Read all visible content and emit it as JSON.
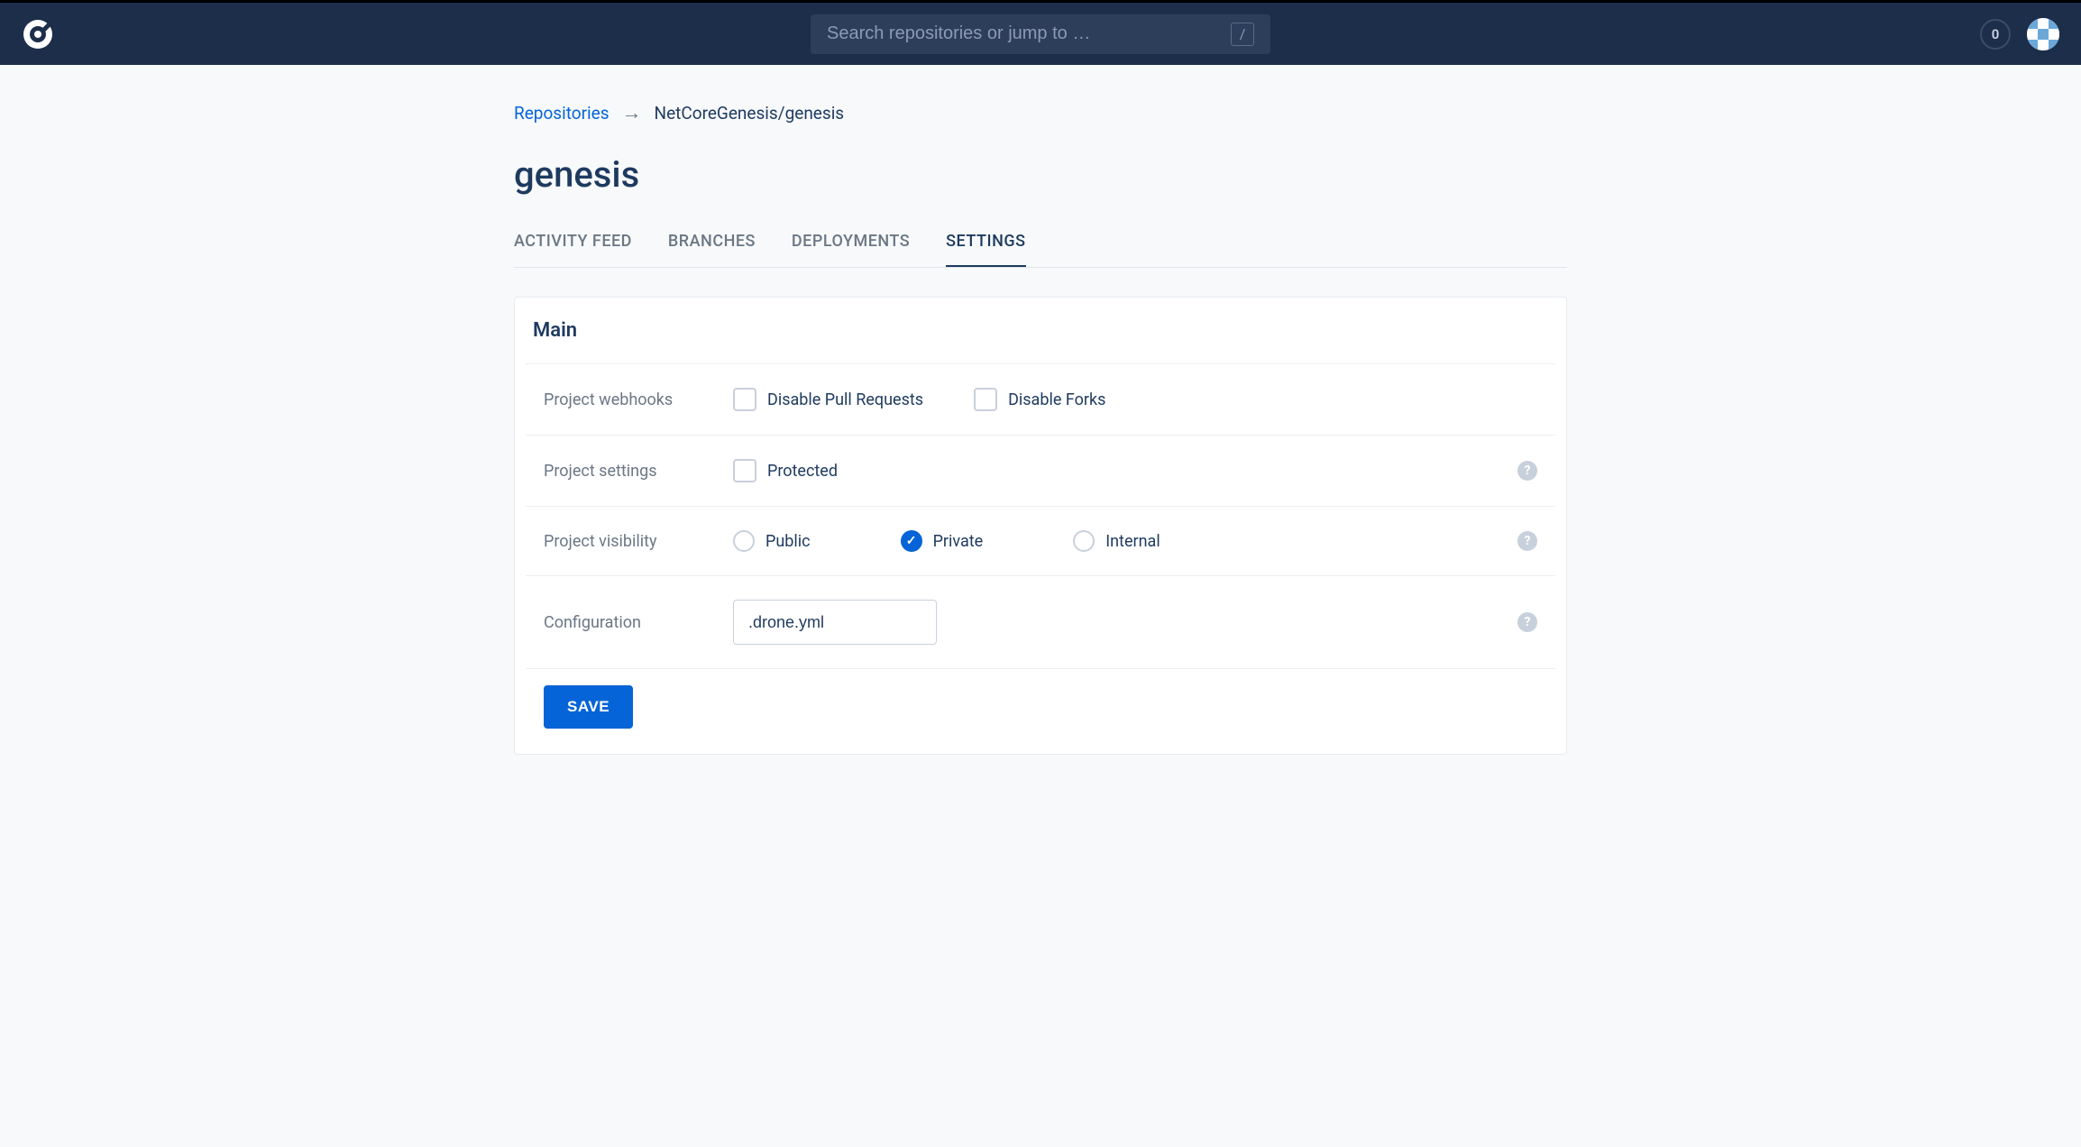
{
  "header": {
    "search_placeholder": "Search repositories or jump to …",
    "search_key": "/",
    "notification_count": "0"
  },
  "breadcrumb": {
    "root": "Repositories",
    "current": "NetCoreGenesis/genesis"
  },
  "page_title": "genesis",
  "tabs": {
    "activity_feed": "ACTIVITY FEED",
    "branches": "BRANCHES",
    "deployments": "DEPLOYMENTS",
    "settings": "SETTINGS"
  },
  "settings": {
    "section_title": "Main",
    "webhooks": {
      "label": "Project webhooks",
      "disable_pull_requests": "Disable Pull Requests",
      "disable_forks": "Disable Forks"
    },
    "project_settings": {
      "label": "Project settings",
      "protected": "Protected"
    },
    "visibility": {
      "label": "Project visibility",
      "public": "Public",
      "private": "Private",
      "internal": "Internal",
      "selected": "private"
    },
    "configuration": {
      "label": "Configuration",
      "value": ".drone.yml"
    },
    "save_button": "SAVE"
  }
}
